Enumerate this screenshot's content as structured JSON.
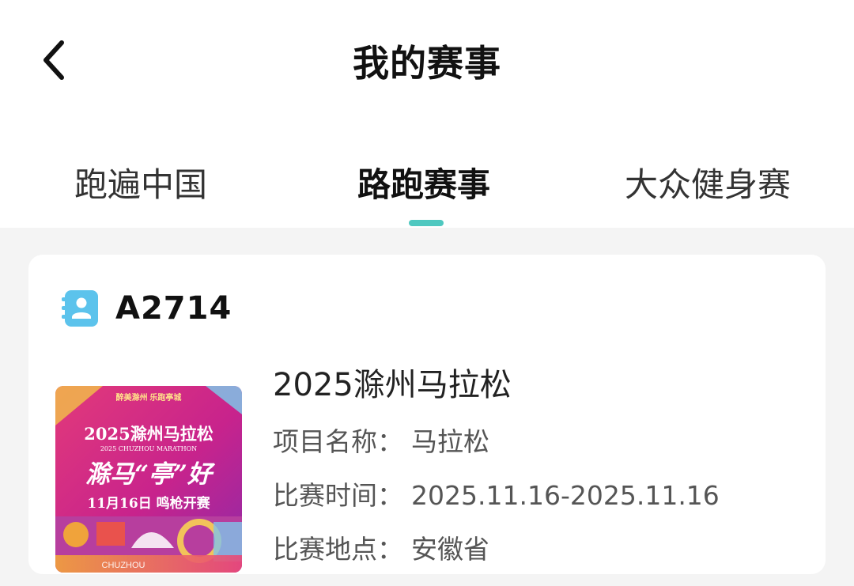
{
  "header": {
    "back_icon": "chevron-left-icon",
    "title": "我的赛事"
  },
  "tabs": [
    {
      "label": "跑遍中国",
      "active": false
    },
    {
      "label": "路跑赛事",
      "active": true
    },
    {
      "label": "大众健身赛",
      "active": false
    }
  ],
  "colors": {
    "accent": "#4fc8c0",
    "background": "#f4f4f4",
    "card": "#ffffff"
  },
  "card": {
    "bib_icon": "contact-book-icon",
    "bib_number": "A2714",
    "poster": {
      "top_slogan": "醉美滁州  乐跑亭城",
      "title": "2025滁州马拉松",
      "subtitle_en": "2025 CHUZHOU MARATHON",
      "calligraphy": "滁马“亭”好",
      "date_line": "11月16日 鸣枪开赛",
      "footer_text": "CHUZHOU"
    },
    "event_title": "2025滁州马拉松",
    "rows": [
      {
        "label": "项目名称：",
        "value": "马拉松"
      },
      {
        "label": "比赛时间：",
        "value": "2025.11.16-2025.11.16"
      },
      {
        "label": "比赛地点：",
        "value": "安徽省"
      }
    ]
  }
}
